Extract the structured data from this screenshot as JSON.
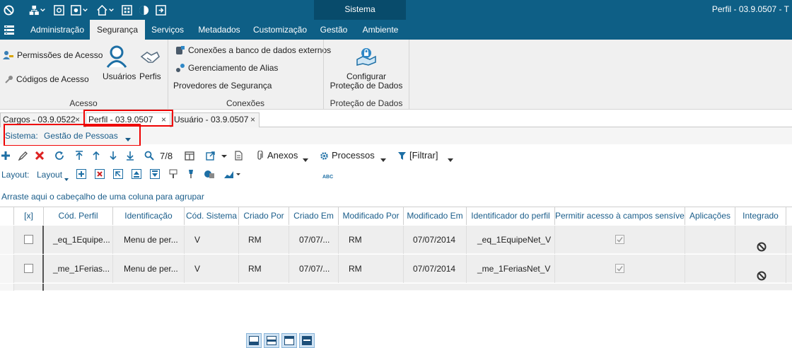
{
  "window": {
    "context_tab": "Sistema",
    "title": "Perfil - 03.9.0507 - T"
  },
  "ribbon_tabs": [
    "Administração",
    "Segurança",
    "Serviços",
    "Metadados",
    "Customização",
    "Gestão",
    "Ambiente"
  ],
  "active_ribbon_tab": "Segurança",
  "ribbon": {
    "acesso": {
      "permissoes": "Permissões de Acesso",
      "codigos": "Códigos de Acesso",
      "usuarios": "Usuários",
      "perfis": "Perfis",
      "title": "Acesso"
    },
    "conexoes": {
      "externos": "Conexões a banco de dados externos",
      "alias": "Gerenciamento de Alias",
      "provedores": "Provedores de Segurança",
      "title": "Conexões"
    },
    "protecao": {
      "configurar_line1": "Configurar",
      "configurar_line2": "Proteção de Dados",
      "title": "Proteção de Dados"
    }
  },
  "doc_tabs": [
    {
      "label": "Cargos - 03.9.0522"
    },
    {
      "label": "Perfil - 03.9.0507"
    },
    {
      "label": "Usuário - 03.9.0507"
    }
  ],
  "close_glyph": "×",
  "system_filter": {
    "label": "Sistema:",
    "value": "Gestão de Pessoas"
  },
  "toolbar": {
    "record_position": "7/8",
    "anexos": "Anexos",
    "processos": "Processos",
    "filtrar": "[Filtrar]",
    "layout_label": "Layout:",
    "layout_menu": "Layout"
  },
  "group_hint": "Arraste aqui o cabeçalho de uma coluna para agrupar",
  "grid": {
    "columns": [
      "[x]",
      "Cód. Perfil",
      "Identificação",
      "Cód. Sistema",
      "Criado Por",
      "Criado Em",
      "Modificado Por",
      "Modificado Em",
      "Identificador do perfil",
      "Permitir acesso à campos sensíveis",
      "Aplicações",
      "Integrado"
    ],
    "rows": [
      {
        "cod_perfil": "_eq_1Equipe...",
        "identificacao": "Menu de per...",
        "cod_sistema": "V",
        "criado_por": "RM",
        "criado_em": "07/07/...",
        "modificado_por": "RM",
        "modificado_em": "07/07/2014",
        "identificador": "_eq_1EquipeNet_V",
        "sensiveis": true
      },
      {
        "cod_perfil": "_me_1Ferias...",
        "identificacao": "Menu de per...",
        "cod_sistema": "V",
        "criado_por": "RM",
        "criado_em": "07/07/...",
        "modificado_por": "RM",
        "modificado_em": "07/07/2014",
        "identificador": "_me_1FeriasNet_V",
        "sensiveis": true
      }
    ]
  },
  "colors": {
    "titlebar": "#0e5f86",
    "context_tab": "#084b6b",
    "accent_text": "#1a5d8a",
    "highlight": "#e00000"
  }
}
